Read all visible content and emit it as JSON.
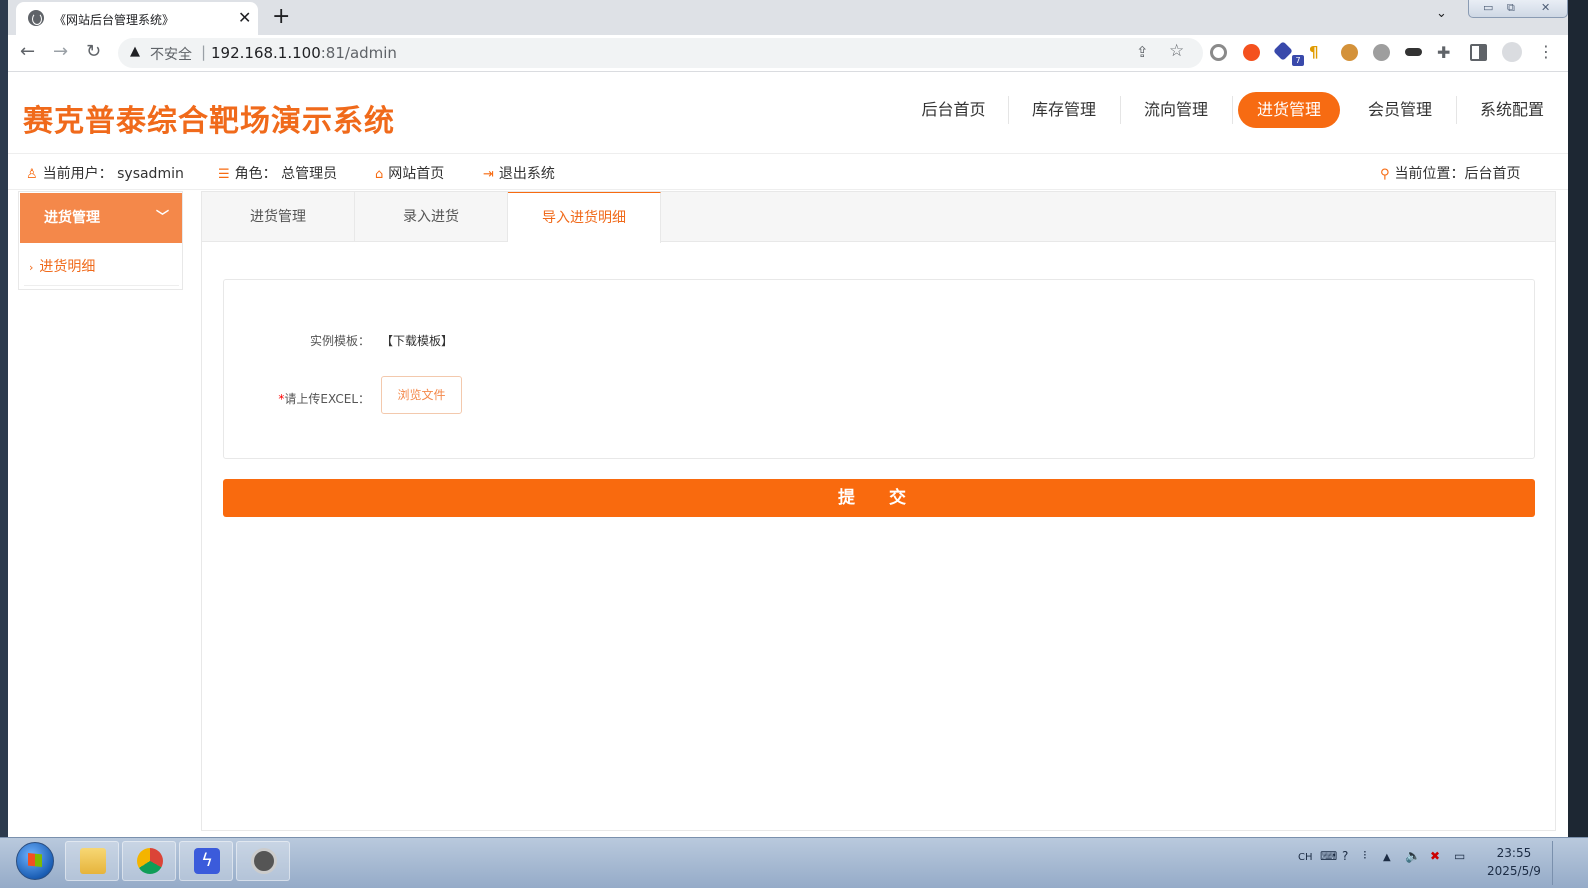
{
  "browser": {
    "tab_title": "《网站后台管理系统》",
    "tab_close": "✕",
    "new_tab": "+",
    "tab_search": "⌄",
    "window_controls": [
      "▭",
      "⧉",
      "✕"
    ],
    "insecure_label": "不安全",
    "separator": "|",
    "url_host": "192.168.1.100",
    "url_path": ":81/admin",
    "extension_badge": "7"
  },
  "site": {
    "logo": "赛克普泰综合靶场演示系统",
    "nav": [
      {
        "label": "后台首页"
      },
      {
        "label": "库存管理"
      },
      {
        "label": "流向管理"
      },
      {
        "label": "进货管理"
      },
      {
        "label": "会员管理"
      },
      {
        "label": "系统配置"
      }
    ],
    "active_nav_color": "#f76b12"
  },
  "infobar": {
    "current_user_label": "当前用户：",
    "current_user": "sysadmin",
    "role_label": "角色：",
    "role": "总管理员",
    "home_link": "网站首页",
    "logout_link": "退出系统",
    "location_label": "当前位置：",
    "location": "后台首页"
  },
  "sidebar": {
    "header": "进货管理",
    "items": [
      {
        "label": "进货明细"
      }
    ]
  },
  "content": {
    "tabs": [
      {
        "label": "进货管理"
      },
      {
        "label": "录入进货"
      },
      {
        "label": "导入进货明细"
      }
    ],
    "form": {
      "template_label": "实例模板：",
      "template_link": "【下载模板】",
      "upload_required": "*",
      "upload_label": "请上传EXCEL：",
      "browse_button": "浏览文件"
    },
    "submit_button": "提 交"
  },
  "taskbar": {
    "ime": "CH",
    "clock_time": "23:55",
    "clock_date": "2025/5/9"
  }
}
